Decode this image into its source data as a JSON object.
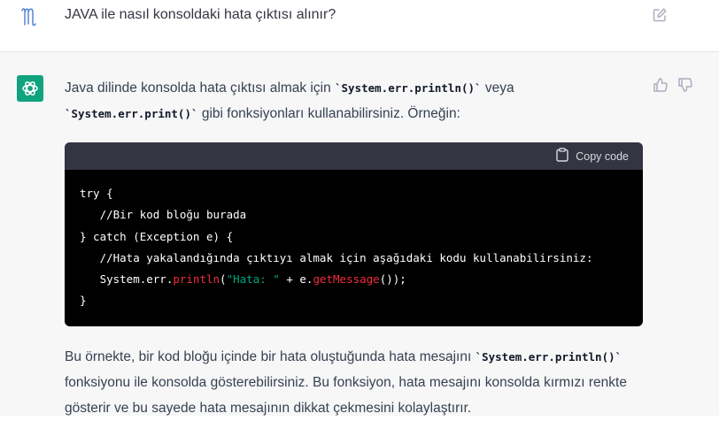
{
  "user_message": {
    "text": "JAVA ile nasıl konsoldaki hata çıktısı alınır?"
  },
  "assistant": {
    "intro": {
      "line1_pre": "Java dilinde konsolda hata çıktısı almak için ",
      "code1": "`System.err.println()`",
      "line1_post": " veya",
      "code2": "`System.err.print()`",
      "line2_post": " gibi fonksiyonları kullanabilirsiniz. Örneğin:"
    },
    "code_block": {
      "copy_label": "Copy code",
      "lines": {
        "l1": "try {",
        "l2": "   //Bir kod bloğu burada",
        "l3": "} catch (Exception e) {",
        "l4": "   //Hata yakalandığında çıktıyı almak için aşağıdaki kodu kullanabilirsiniz:",
        "l5_pre": "   System.err.",
        "l5_fn": "println",
        "l5_open": "(",
        "l5_str": "\"Hata: \"",
        "l5_mid": " + e.",
        "l5_fn2": "getMessage",
        "l5_post": "());",
        "l6": "}"
      }
    },
    "outro": {
      "line1_pre": "Bu örnekte, bir kod bloğu içinde bir hata oluştuğunda hata mesajını ",
      "code": "`System.err.println()`",
      "line2": "fonksiyonu ile konsolda gösterebilirsiniz. Bu fonksiyon, hata mesajını konsolda kırmızı renkte",
      "line3": "gösterir ve bu sayede hata mesajının dikkat çekmesini kolaylaştırır."
    }
  },
  "colors": {
    "brand_green": "#10a37f",
    "assistant_bg": "#f7f7f8",
    "code_bg": "#000000",
    "code_header_bg": "#343541",
    "string_color": "#00a67d",
    "function_color": "#f22c3d"
  },
  "icons": {
    "user_avatar": "user-avatar-icon",
    "edit": "edit-icon",
    "bot_avatar": "openai-logo-icon",
    "thumbs_up": "thumbs-up-icon",
    "thumbs_down": "thumbs-down-icon",
    "copy": "clipboard-icon"
  }
}
